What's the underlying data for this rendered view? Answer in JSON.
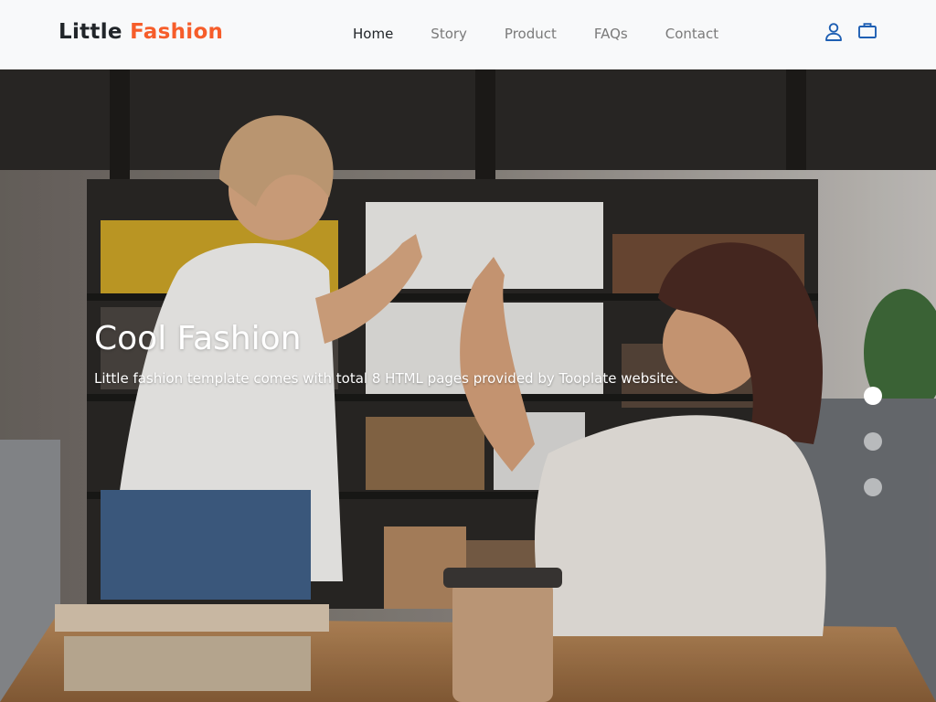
{
  "brand": {
    "name": "Little",
    "accent": "Fashion"
  },
  "nav": {
    "items": [
      {
        "label": "Home",
        "active": true
      },
      {
        "label": "Story",
        "active": false
      },
      {
        "label": "Product",
        "active": false
      },
      {
        "label": "FAQs",
        "active": false
      },
      {
        "label": "Contact",
        "active": false
      }
    ],
    "icons": [
      "user-icon",
      "shopping-bag-icon"
    ]
  },
  "hero": {
    "title": "Cool Fashion",
    "text": "Little fashion template comes with total 8 HTML pages provided by Tooplate website.",
    "slides": 3,
    "active_slide": 1
  },
  "colors": {
    "accent": "#f65d2a",
    "nav_bg": "#f8f9fa",
    "icon_blue": "#1e5fb3"
  }
}
